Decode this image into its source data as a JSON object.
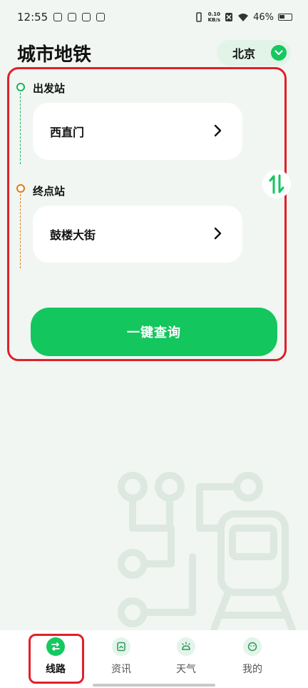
{
  "status_bar": {
    "time": "12:55",
    "network_speed_value": "0.10",
    "network_speed_unit": "KB/s",
    "battery": "46%"
  },
  "header": {
    "title": "城市地铁",
    "city": "北京"
  },
  "route": {
    "start_label": "出发站",
    "start_station": "西直门",
    "end_label": "终点站",
    "end_station": "鼓楼大街",
    "query_label": "一键查询"
  },
  "nav": {
    "items": [
      {
        "label": "线路",
        "icon": "route-icon",
        "active": true
      },
      {
        "label": "资讯",
        "icon": "news-icon",
        "active": false
      },
      {
        "label": "天气",
        "icon": "weather-icon",
        "active": false
      },
      {
        "label": "我的",
        "icon": "profile-icon",
        "active": false
      }
    ]
  },
  "colors": {
    "accent": "#13c65e",
    "start_marker": "#1bb35a",
    "end_marker": "#e07b1a",
    "highlight": "#e0202a"
  }
}
